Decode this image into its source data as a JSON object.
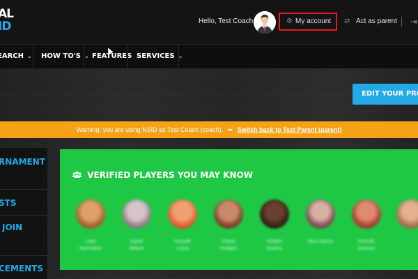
{
  "header": {
    "logo_line1": "AL",
    "logo_line2": "ID",
    "greeting": "Hello, Test Coach",
    "my_account_label": "My account",
    "act_as_parent_label": "Act as parent"
  },
  "nav": {
    "items": [
      {
        "label": "EARCH"
      },
      {
        "label": "HOW TO'S"
      },
      {
        "label": "FEATURES"
      },
      {
        "label": "SERVICES"
      }
    ]
  },
  "edit_profile_label": "EDIT YOUR PROFILE",
  "warning": {
    "text": "Warning: you are using NSID as Test Coach (coach).",
    "switch_label": "Switch back to Test Parent (parent)"
  },
  "sidebar": {
    "items": [
      {
        "label": "RNAMENTS"
      },
      {
        "label": "STS"
      },
      {
        "label": "JOIN"
      },
      {
        "label": "CEMENTS"
      }
    ]
  },
  "panel": {
    "title": "VERIFIED PLAYERS YOU MAY KNOW",
    "players": [
      {
        "name_line1": "Luke",
        "name_line2": "Ioannidesi"
      },
      {
        "name_line1": "Isaiah",
        "name_line2": "Wilson"
      },
      {
        "name_line1": "Kenyell",
        "name_line2": "Lucas"
      },
      {
        "name_line1": "Chase",
        "name_line2": "Hodges"
      },
      {
        "name_line1": "Kolden",
        "name_line2": "Suarez"
      },
      {
        "name_line1": "Max Ganzo",
        "name_line2": ""
      },
      {
        "name_line1": "Kennith",
        "name_line2": "Duncan"
      },
      {
        "name_line1": "",
        "name_line2": ""
      }
    ]
  },
  "colors": {
    "accent_blue": "#22a9e6",
    "warning_orange": "#f5a216",
    "panel_green": "#1ec845",
    "highlight_red": "#e41b1b"
  },
  "icons": {
    "gear": "gear-icon",
    "swap": "swap-arrows-icon",
    "logout": "logout-icon",
    "users": "users-icon",
    "switch": "switch-arrow-icon"
  }
}
